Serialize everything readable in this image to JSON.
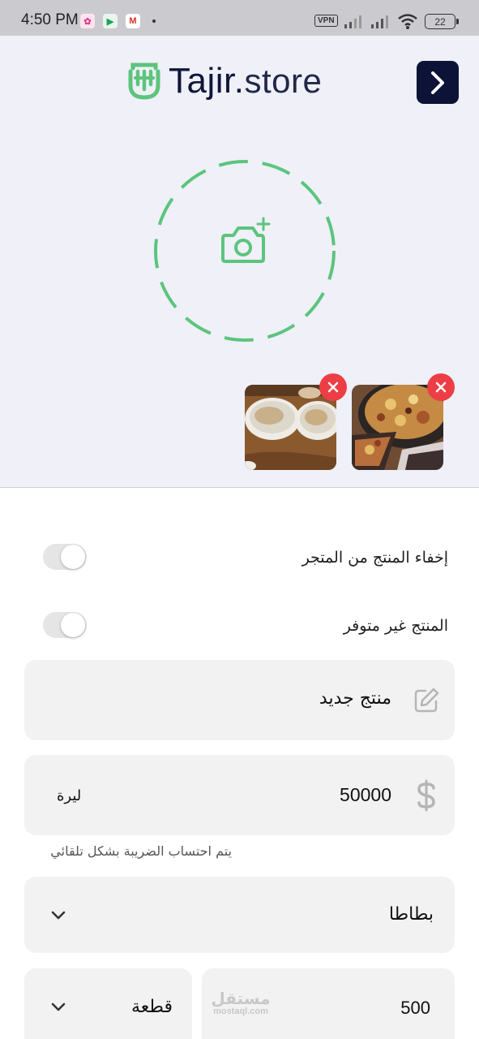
{
  "status_bar": {
    "time": "4:50 PM",
    "vpn": "VPN",
    "battery": "22",
    "apps": [
      {
        "name": "photos-app-icon",
        "glyph": "✿",
        "bg": "#ffe4ef",
        "fg": "#e23b8a"
      },
      {
        "name": "play-store-icon",
        "glyph": "▶",
        "bg": "#e8f6ee",
        "fg": "#1aa260"
      },
      {
        "name": "gmail-icon",
        "glyph": "M",
        "bg": "#ffffff",
        "fg": "#d93025"
      }
    ]
  },
  "header": {
    "logo_name": "Tajir",
    "logo_dot": ".",
    "logo_suffix": "store",
    "next_icon": "chevron-right-icon"
  },
  "media": {
    "add_photo_icon": "camera-plus-icon",
    "thumbnails": [
      {
        "name": "thumbnail-pizza",
        "remove_icon": "close-icon"
      },
      {
        "name": "thumbnail-pies",
        "remove_icon": "close-icon"
      }
    ]
  },
  "form": {
    "hide_product_label": "إخفاء المنتج من المتجر",
    "hide_product_on": false,
    "unavailable_label": "المنتج غير متوفر",
    "unavailable_on": false,
    "name_value": "منتج جديد",
    "name_icon": "edit-icon",
    "price_value": "50000",
    "price_icon": "dollar-icon",
    "currency": "ليرة",
    "tax_hint": "يتم احتساب الضريبة بشكل تلقائي",
    "category_value": "بطاطا",
    "quantity_value": "500",
    "unit_value": "قطعة",
    "watermark_ar": "مستقل",
    "watermark_en": "mostaql.com"
  },
  "colors": {
    "brand_green": "#5cc47d",
    "brand_navy": "#0d1237",
    "remove_red": "#ed3e45",
    "field_bg": "#f2f2f2"
  }
}
